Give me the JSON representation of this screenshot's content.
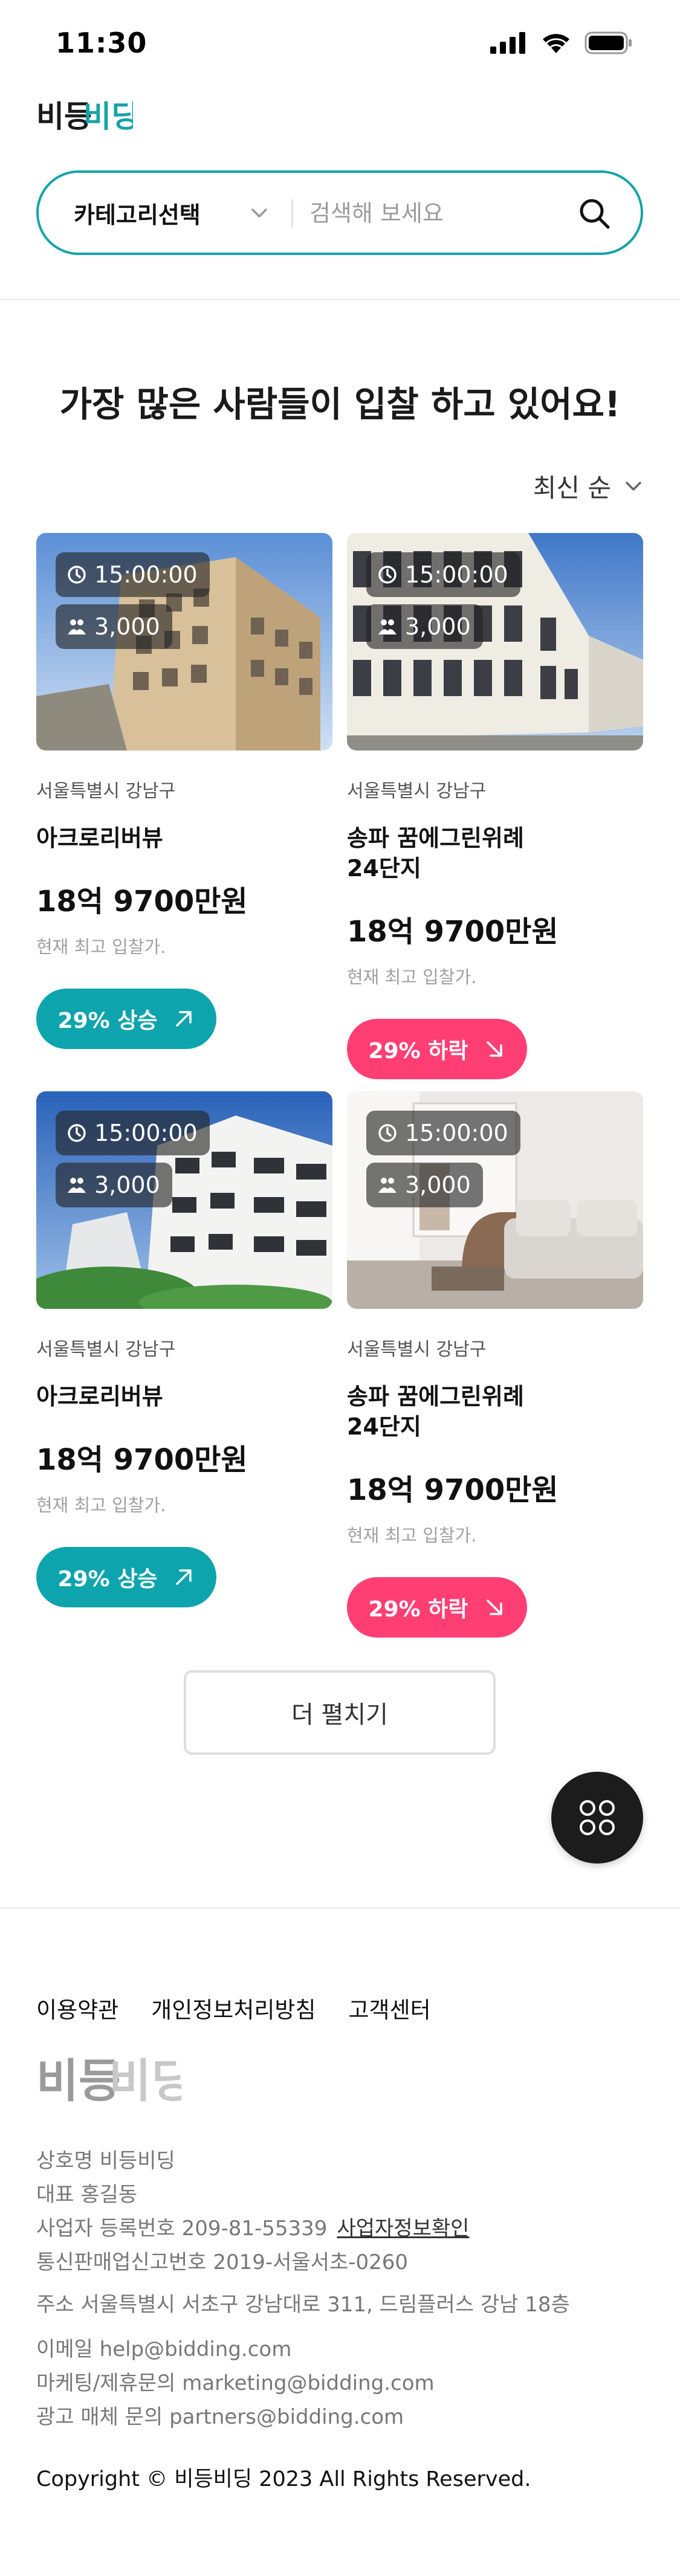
{
  "status_bar": {
    "time": "11:30"
  },
  "header": {
    "logo_text": "비등비딩",
    "search": {
      "category_label": "카테고리선택",
      "placeholder": "검색해 보세요"
    }
  },
  "main": {
    "section_title": "가장 많은 사람들이 입찰 하고 있어요!",
    "sort_label": "최신 순",
    "listings": [
      {
        "image": "building-tan",
        "time_left": "15:00:00",
        "bidders": "3,000",
        "location": "서울특별시 강남구",
        "name": "아크로리버뷰",
        "price": "18억 9700만원",
        "price_caption": "현재 최고 입찰가.",
        "trend_label": "29% 상승",
        "trend": "up",
        "trend_color": "#0ea4ad"
      },
      {
        "image": "building-glass",
        "time_left": "15:00:00",
        "bidders": "3,000",
        "location": "서울특별시 강남구",
        "name": "송파 꿈에그린위례\n24단지",
        "price": "18억 9700만원",
        "price_caption": "현재 최고 입찰가.",
        "trend_label": "29% 하락",
        "trend": "down",
        "trend_color": "#ff3f74"
      },
      {
        "image": "building-white",
        "time_left": "15:00:00",
        "bidders": "3,000",
        "location": "서울특별시 강남구",
        "name": "아크로리버뷰",
        "price": "18억 9700만원",
        "price_caption": "현재 최고 입찰가.",
        "trend_label": "29% 상승",
        "trend": "up",
        "trend_color": "#0ea4ad"
      },
      {
        "image": "interior-living-room",
        "time_left": "15:00:00",
        "bidders": "3,000",
        "location": "서울특별시 강남구",
        "name": "송파 꿈에그린위례\n24단지",
        "price": "18억 9700만원",
        "price_caption": "현재 최고 입찰가.",
        "trend_label": "29% 하락",
        "trend": "down",
        "trend_color": "#ff3f74"
      }
    ],
    "more_label": "더 펼치기"
  },
  "footer": {
    "links": [
      "이용약관",
      "개인정보처리방침",
      "고객센터"
    ],
    "logo_text": "비등비딩",
    "company_name": "상호명 비등비딩",
    "representative": "대표 홍길동",
    "business_number": "사업자 등록번호 209-81-55339",
    "business_check_link": "사업자정보확인",
    "mail_order_number": "통신판매업신고번호 2019-서울서초-0260",
    "address": "주소 서울특별시 서초구 강남대로 311, 드림플러스 강남 18층",
    "email": "이메일 help@bidding.com",
    "marketing": "마케팅/제휴문의 marketing@bidding.com",
    "ads": "광고 매체 문의 partners@bidding.com",
    "copyright": "Copyright © 비등비딩 2023 All Rights Reserved."
  },
  "colors": {
    "accent": "#14a3a8",
    "up": "#0ea4ad",
    "down": "#ff3f74",
    "logo_dark": "#1a1a1a"
  },
  "icons": [
    "signal-icon",
    "wifi-icon",
    "battery-icon",
    "chevron-down-icon",
    "search-icon",
    "clock-icon",
    "users-icon",
    "arrow-up-right-icon",
    "arrow-down-right-icon",
    "grid-menu-icon"
  ]
}
